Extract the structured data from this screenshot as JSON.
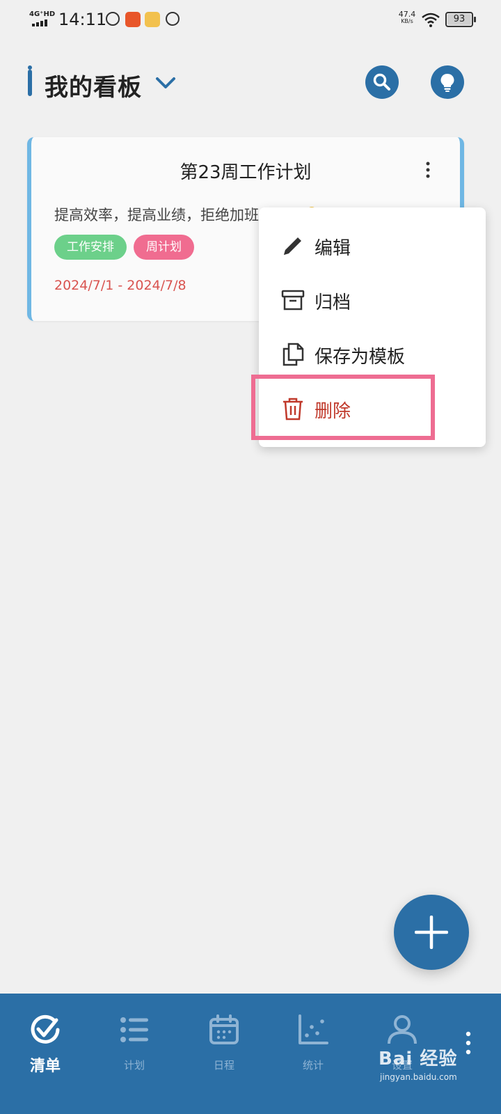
{
  "status_bar": {
    "network": "4G⁺HD",
    "time": "14:11",
    "speed_value": "47.4",
    "speed_unit": "KB/s",
    "battery": "93"
  },
  "header": {
    "title": "我的看板",
    "icons": {
      "dropdown": "chevron-down-icon",
      "search": "search-icon",
      "tips": "lightbulb-icon"
    }
  },
  "board_card": {
    "title": "第23周工作计划",
    "description": "提高效率，提高业绩，拒绝加班",
    "tags": [
      {
        "label": "工作安排",
        "color": "#6cd08a"
      },
      {
        "label": "周计划",
        "color": "#f06c90"
      }
    ],
    "date_range": "2024/7/1 - 2024/7/8"
  },
  "menu": {
    "items": [
      {
        "label": "编辑",
        "icon": "pencil-icon"
      },
      {
        "label": "归档",
        "icon": "archive-icon"
      },
      {
        "label": "保存为模板",
        "icon": "copy-icon"
      },
      {
        "label": "删除",
        "icon": "trash-icon"
      }
    ],
    "highlighted_item": "删除"
  },
  "fab": {
    "icon": "plus-icon"
  },
  "bottom_nav": {
    "items": [
      {
        "label": "清单",
        "icon": "check-circle-icon",
        "active": true
      },
      {
        "label": "计划",
        "icon": "list-icon",
        "active": false
      },
      {
        "label": "日程",
        "icon": "calendar-icon",
        "active": false
      },
      {
        "label": "统计",
        "icon": "scatter-chart-icon",
        "active": false
      },
      {
        "label": "设置",
        "icon": "person-icon",
        "active": false
      }
    ]
  },
  "watermark": {
    "main": "Bai 经验",
    "sub": "jingyan.baidu.com"
  },
  "colors": {
    "primary": "#2b6fa6",
    "card_accent": "#6fb7e4",
    "date_text": "#d9534f",
    "delete_text": "#c0392b",
    "highlight_box": "#ee6d92",
    "background": "#f0f0f0"
  }
}
